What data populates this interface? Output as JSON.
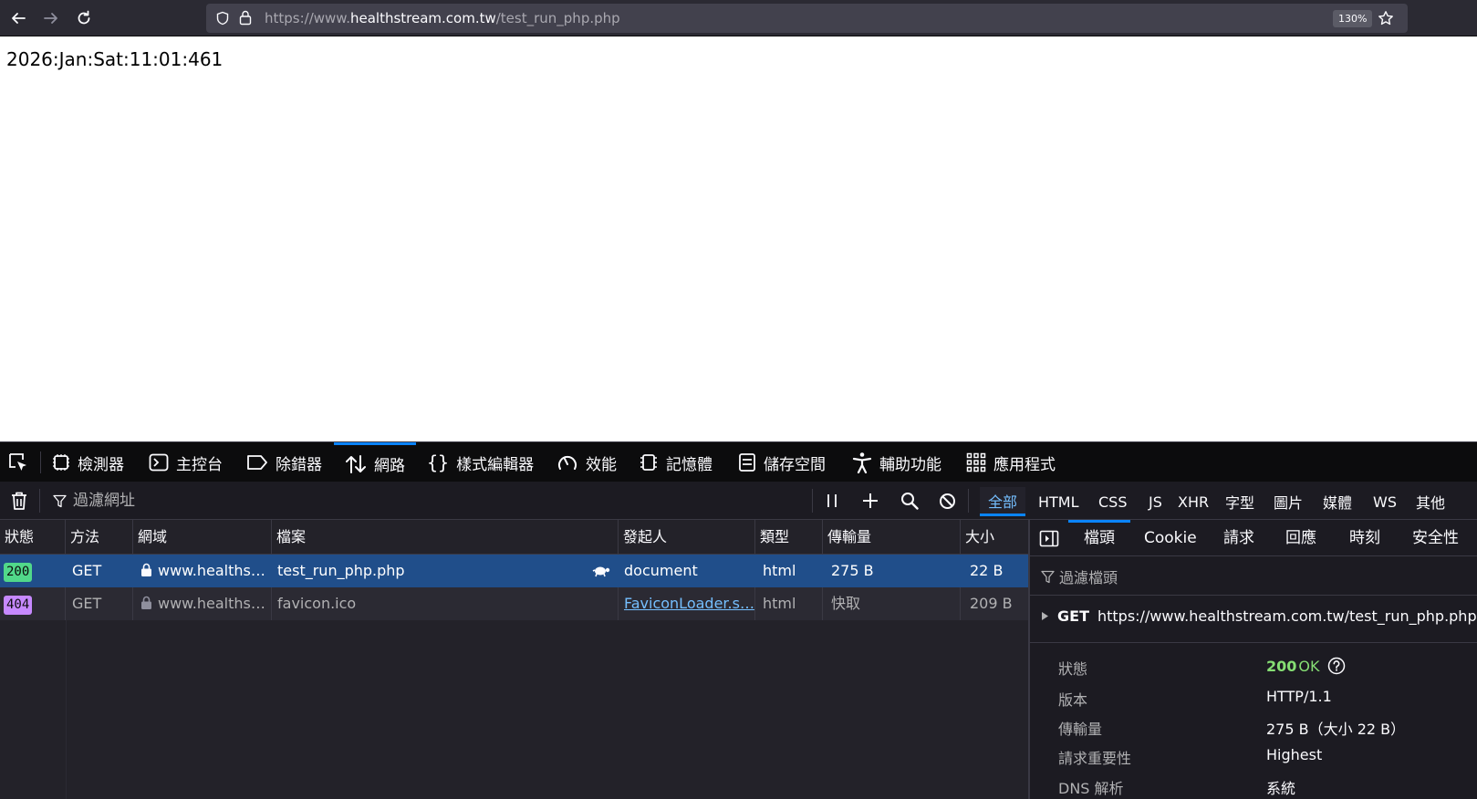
{
  "browser": {
    "url_prefix": "https://www.",
    "url_host": "healthstream.com.tw",
    "url_path": "/test_run_php.php",
    "zoom": "130%"
  },
  "page": {
    "text": "2026:Jan:Sat:11:01:461"
  },
  "devtools": {
    "tabs": [
      {
        "label": "檢測器",
        "icon": "inspector-icon"
      },
      {
        "label": "主控台",
        "icon": "console-icon"
      },
      {
        "label": "除錯器",
        "icon": "debugger-icon"
      },
      {
        "label": "網路",
        "icon": "network-icon",
        "active": true
      },
      {
        "label": "樣式編輯器",
        "icon": "style-editor-icon"
      },
      {
        "label": "效能",
        "icon": "performance-icon"
      },
      {
        "label": "記憶體",
        "icon": "memory-icon"
      },
      {
        "label": "儲存空間",
        "icon": "storage-icon"
      },
      {
        "label": "輔助功能",
        "icon": "accessibility-icon"
      },
      {
        "label": "應用程式",
        "icon": "application-icon"
      }
    ],
    "toolbar": {
      "filter_placeholder": "過濾網址",
      "type_filters": [
        "全部",
        "HTML",
        "CSS",
        "JS",
        "XHR",
        "字型",
        "圖片",
        "媒體",
        "WS",
        "其他"
      ]
    },
    "table": {
      "headers": [
        "狀態",
        "方法",
        "網域",
        "檔案",
        "發起人",
        "類型",
        "傳輸量",
        "大小"
      ],
      "rows": [
        {
          "status": "200",
          "method": "GET",
          "domain": "www.healths…",
          "file": "test_run_php.php",
          "initiator": "document",
          "type": "html",
          "transferred": "275 B",
          "size": "22 B"
        },
        {
          "status": "404",
          "method": "GET",
          "domain": "www.healths…",
          "file": "favicon.ico",
          "initiator": "FaviconLoader.s…",
          "type": "html",
          "transferred": "快取",
          "size": "209 B"
        }
      ]
    },
    "details": {
      "tabs": [
        "檔頭",
        "Cookie",
        "請求",
        "回應",
        "時刻",
        "安全性"
      ],
      "filter_placeholder": "過濾檔頭",
      "request_method": "GET",
      "request_url": "https://www.healthstream.com.tw/test_run_php.php",
      "status_label": "狀態",
      "status_code": "200",
      "status_text": "OK",
      "version_label": "版本",
      "version_value": "HTTP/1.1",
      "transferred_label": "傳輸量",
      "transferred_value": "275 B（大小 22 B）",
      "priority_label": "請求重要性",
      "priority_value": "Highest",
      "dns_label": "DNS 解析",
      "dns_value": "系統"
    }
  }
}
